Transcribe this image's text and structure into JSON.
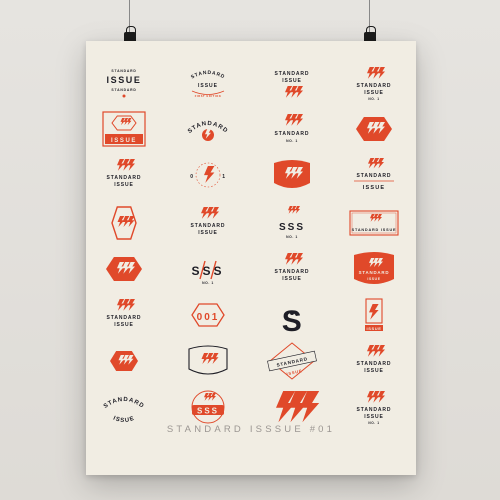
{
  "poster": {
    "footer": "STANDARD ISSSUE #01",
    "colors": {
      "paper": "#f1ede3",
      "accent": "#e0492a",
      "ink": "#1e1e26"
    }
  },
  "logos": [
    {
      "row": 0,
      "col": 0,
      "kind": "stack",
      "line1": "STANDARD",
      "line2": "ISSUE",
      "pre": "STANDARD"
    },
    {
      "row": 0,
      "col": 1,
      "kind": "arch",
      "line1": "STANDARD",
      "line2": "ISSUE",
      "line3": "FIRST EDITION"
    },
    {
      "row": 0,
      "col": 2,
      "kind": "stack-bolts",
      "line1": "STANDARD",
      "line2": "ISSUE"
    },
    {
      "row": 0,
      "col": 3,
      "kind": "bolts-text",
      "line1": "STANDARD",
      "line2": "ISSUE",
      "line3": "NO. 1"
    },
    {
      "row": 1,
      "col": 0,
      "kind": "hex-frame",
      "line2": "ISSUE"
    },
    {
      "row": 1,
      "col": 1,
      "kind": "arc-bolt",
      "line1": "STANDARD"
    },
    {
      "row": 1,
      "col": 2,
      "kind": "bolts-small",
      "line1": "STANDARD",
      "line2": "NO. 1"
    },
    {
      "row": 1,
      "col": 3,
      "kind": "hex-solid"
    },
    {
      "row": 2,
      "col": 0,
      "kind": "bolts-text",
      "line1": "STANDARD",
      "line2": "ISSUE"
    },
    {
      "row": 2,
      "col": 1,
      "kind": "bolt-ring",
      "left": "0",
      "right": "1"
    },
    {
      "row": 2,
      "col": 2,
      "kind": "badge-solid"
    },
    {
      "row": 2,
      "col": 3,
      "kind": "round-text",
      "line1": "STANDARD",
      "line2": "ISSUE"
    },
    {
      "row": 3,
      "col": 0,
      "kind": "hex-bolts"
    },
    {
      "row": 3,
      "col": 1,
      "kind": "bolts-text",
      "line1": "STANDARD",
      "line2": "ISSUE"
    },
    {
      "row": 3,
      "col": 2,
      "kind": "sss",
      "line1": "SSS",
      "line2": "NO. 1"
    },
    {
      "row": 3,
      "col": 3,
      "kind": "rect-frame",
      "line1": "STANDARD ISSUE"
    },
    {
      "row": 4,
      "col": 0,
      "kind": "hex-solid"
    },
    {
      "row": 4,
      "col": 1,
      "kind": "sss-slash",
      "line1": "SSS",
      "line2": "NO. 1"
    },
    {
      "row": 4,
      "col": 2,
      "kind": "bolts-text",
      "line1": "STANDARD",
      "line2": "ISSUE"
    },
    {
      "row": 4,
      "col": 3,
      "kind": "badge-solid-text",
      "line1": "STANDARD",
      "line2": "ISSUE"
    },
    {
      "row": 5,
      "col": 0,
      "kind": "bolts-text",
      "line1": "STANDARD",
      "line2": "ISSUE"
    },
    {
      "row": 5,
      "col": 1,
      "kind": "hex-outline",
      "line1": "001"
    },
    {
      "row": 5,
      "col": 2,
      "kind": "big-s"
    },
    {
      "row": 5,
      "col": 3,
      "kind": "bolt-box",
      "line1": "ISSUE"
    },
    {
      "row": 6,
      "col": 0,
      "kind": "hex-solid-sm"
    },
    {
      "row": 6,
      "col": 1,
      "kind": "badge-outline"
    },
    {
      "row": 6,
      "col": 2,
      "kind": "diamond-band",
      "line1": "STANDARD",
      "line2": "ISSUE"
    },
    {
      "row": 6,
      "col": 3,
      "kind": "bolts-text",
      "line1": "STANDARD",
      "line2": "ISSUE"
    },
    {
      "row": 7,
      "col": 0,
      "kind": "arc-text",
      "line1": "STANDARD",
      "line2": "ISSUE"
    },
    {
      "row": 7,
      "col": 1,
      "kind": "badge-sss",
      "line1": "SSS"
    },
    {
      "row": 7,
      "col": 2,
      "kind": "big-bolts"
    },
    {
      "row": 7,
      "col": 3,
      "kind": "bolts-text",
      "line1": "STANDARD",
      "line2": "ISSUE",
      "line3": "NO. 1"
    }
  ]
}
